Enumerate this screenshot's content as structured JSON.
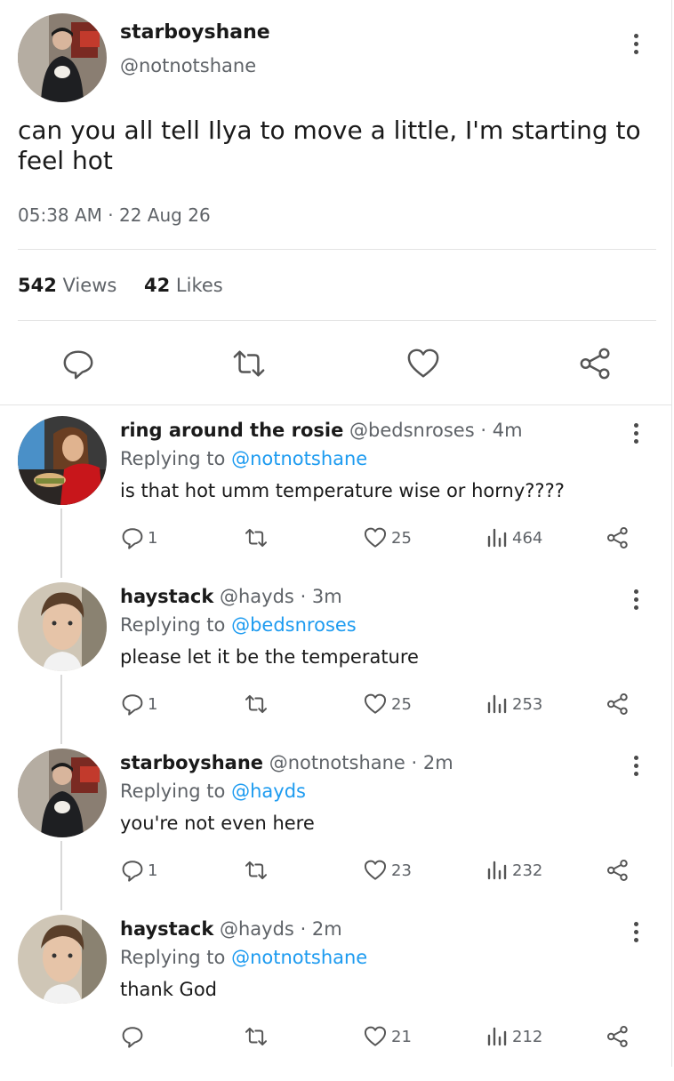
{
  "tweet": {
    "author_name": "starboyshane",
    "author_handle": "@notnotshane",
    "text": "can you all tell Ilya to move a little, I'm starting to feel hot",
    "timestamp": "05:38 AM · 22 Aug 26",
    "views_count": "542",
    "views_label": "Views",
    "likes_count": "42",
    "likes_label": "Likes",
    "actions": [
      "comment-icon",
      "retweet-icon",
      "heart-icon",
      "share-icon"
    ]
  },
  "replies": [
    {
      "name": "ring around the rosie",
      "handle": "@bedsnroses",
      "time": "· 4m",
      "replying_prefix": "Replying to",
      "replying_to": "@notnotshane",
      "text": "is that hot umm temperature wise or horny????",
      "comments": "1",
      "likes": "25",
      "views": "464"
    },
    {
      "name": "haystack",
      "handle": "@hayds",
      "time": "· 3m",
      "replying_prefix": "Replying to",
      "replying_to": "@bedsnroses",
      "text": "please let it be the temperature",
      "comments": "1",
      "likes": "25",
      "views": "253"
    },
    {
      "name": "starboyshane",
      "handle": "@notnotshane",
      "time": "· 2m",
      "replying_prefix": "Replying to",
      "replying_to": "@hayds",
      "text": "you're not even here",
      "comments": "1",
      "likes": "23",
      "views": "232"
    },
    {
      "name": "haystack",
      "handle": "@hayds",
      "time": "· 2m",
      "replying_prefix": "Replying to",
      "replying_to": "@notnotshane",
      "text": "thank God",
      "comments": "",
      "likes": "21",
      "views": "212"
    }
  ],
  "colors": {
    "accent": "#1d9bf0",
    "text": "#1a1a1a",
    "muted": "#5f6368",
    "divider": "#e4e4e4"
  }
}
